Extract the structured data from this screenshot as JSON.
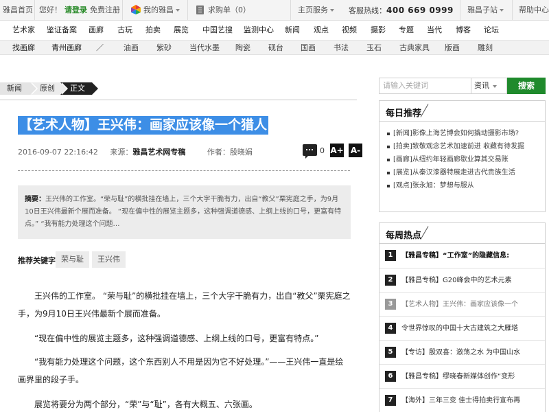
{
  "topbar": {
    "home": "雅昌首页",
    "greeting": "您好！",
    "login": "请登录",
    "register": "免费注册",
    "my_artron": "我的雅昌",
    "cart": "求购单（0）",
    "services": "主页服务",
    "hotline_label": "客服热线：",
    "hotline": "400 669 0999",
    "substations": "雅昌子站",
    "help": "帮助中心"
  },
  "nav_main": [
    "艺术家",
    "鉴证备案",
    "画廊",
    "古玩",
    "拍卖",
    "展览",
    "中国艺搜",
    "监测中心",
    "新闻",
    "观点",
    "视频",
    "摄影",
    "专题",
    "当代",
    "博客",
    "论坛"
  ],
  "nav_sub": [
    "找画廊",
    "青州画廊",
    "／",
    "油画",
    "紫砂",
    "当代水墨",
    "陶瓷",
    "砚台",
    "国画",
    "书法",
    "玉石",
    "古典家具",
    "版画",
    "雕刻"
  ],
  "breadcrumb": [
    "新闻",
    "原创",
    "正文"
  ],
  "article": {
    "title": "【艺术人物】王兴伟：画家应该像一个猎人",
    "date": "2016-09-07 22:16:42",
    "source_label": "来源：",
    "source": "雅昌艺术网专稿",
    "author_label": "作者：",
    "author": "殷晓娟",
    "comment_count": "0",
    "font_plus": "A+",
    "font_minus": "A-",
    "summary_label": "摘要：",
    "summary": "王兴伟的工作室。“荣与耻”的横批挂在墙上，三个大字干脆有力，出自“教父”栗宪庭之手，为9月10日王兴伟最新个展而准备。 “现在偏中性的展览主题多，这种强调道德感、上纲上线的口号，更富有特点。” “我有能力处理这个问题…",
    "keywords_label": "推荐关键字",
    "keywords": [
      "荣与耻",
      "王兴伟"
    ],
    "paragraphs": [
      "王兴伟的工作室。 “荣与耻”的横批挂在墙上，三个大字干脆有力，出自“教父”栗宪庭之手，为9月10日王兴伟最新个展而准备。",
      "“现在偏中性的展览主题多，这种强调道德感、上纲上线的口号，更富有特点。”",
      "“我有能力处理这个问题，这个东西别人不用是因为它不好处理。”——王兴伟一直是绘画界里的段子手。",
      "展览将要分为两个部分，“荣”与“耻”，各有大概五、六张画。"
    ]
  },
  "search": {
    "placeholder": "请输入关键词",
    "category": "资讯",
    "button": "搜索"
  },
  "daily": {
    "title": "每日推荐",
    "items": [
      "[新闻]影像上海艺博会如何撬动摄影市场?",
      "[拍卖]致敬观念艺术加速前进 收藏有待发掘",
      "[画廊]从纽约年轻画廊歇业算其交易账",
      "[展览]从秦汉漆器特展走进古代贵族生活",
      "[观点]张永旭：梦想与服从"
    ]
  },
  "weekly": {
    "title": "每周热点",
    "items": [
      {
        "num": "1",
        "text": "【雅昌专稿】“工作室”的隐藏信息:"
      },
      {
        "num": "2",
        "text": "【雅昌专稿】G20峰会中的艺术元素"
      },
      {
        "num": "3",
        "text": "【艺术人物】王兴伟：画家应该像一个"
      },
      {
        "num": "4",
        "text": "令世界惊叹的中国十大古建筑之大雁塔"
      },
      {
        "num": "5",
        "text": "【专访】殷双喜：激荡之水 为中国山水"
      },
      {
        "num": "6",
        "text": "【雅昌专稿】缪晓春新媒体创作“变形"
      },
      {
        "num": "7",
        "text": "【海外】三年三变 佳士得拍卖行宣布再"
      }
    ]
  }
}
